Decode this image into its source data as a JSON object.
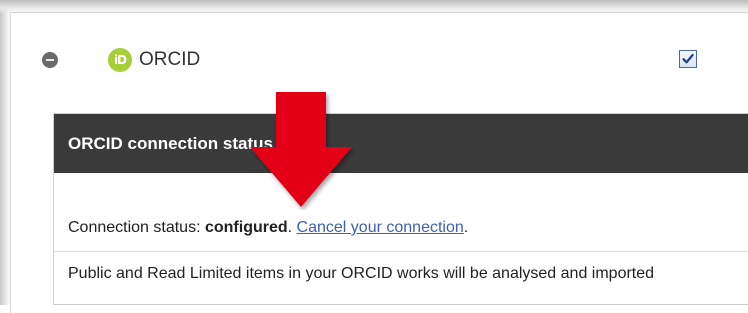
{
  "orcid": {
    "logo_text": "iD",
    "title": "ORCID",
    "enabled": true
  },
  "status_panel": {
    "header": "ORCID connection status",
    "status_prefix": "Connection status: ",
    "status_value": "configured",
    "status_period": ".",
    "cancel_link": "Cancel your connection",
    "cancel_period": ".",
    "info": "Public and Read Limited items in your ORCID works will be analysed and imported"
  },
  "colors": {
    "orcid_green": "#a6ce39",
    "header_bg": "#3a3a3a",
    "link": "#3f5fb0",
    "arrow": "#e30613"
  }
}
